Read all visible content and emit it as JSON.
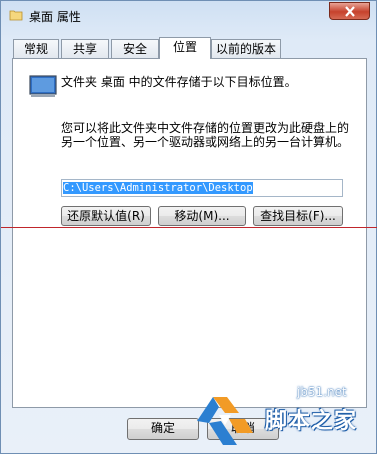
{
  "window": {
    "title": "桌面 属性"
  },
  "tabs": [
    {
      "label": "常规"
    },
    {
      "label": "共享"
    },
    {
      "label": "安全"
    },
    {
      "label": "位置"
    },
    {
      "label": "以前的版本"
    }
  ],
  "active_tab": "位置",
  "location": {
    "description": "文件夹 桌面 中的文件存储于以下目标位置。",
    "explanation": "您可以将此文件夹中文件存储的位置更改为此硬盘上的另一个位置、另一个驱动器或网络上的另一台计算机。",
    "path_value": "C:\\Users\\Administrator\\Desktop",
    "restore_default_label": "还原默认值(R)",
    "move_label": "移动(M)...",
    "find_target_label": "查找目标(F)..."
  },
  "footer": {
    "ok_label": "确定",
    "cancel_label": "取消"
  },
  "watermark": {
    "site": "jb51.net",
    "name": "脚本之家"
  },
  "colors": {
    "accent": "#3399ff",
    "annotation_line": "#c0262c",
    "close_button": "#c6422c"
  }
}
